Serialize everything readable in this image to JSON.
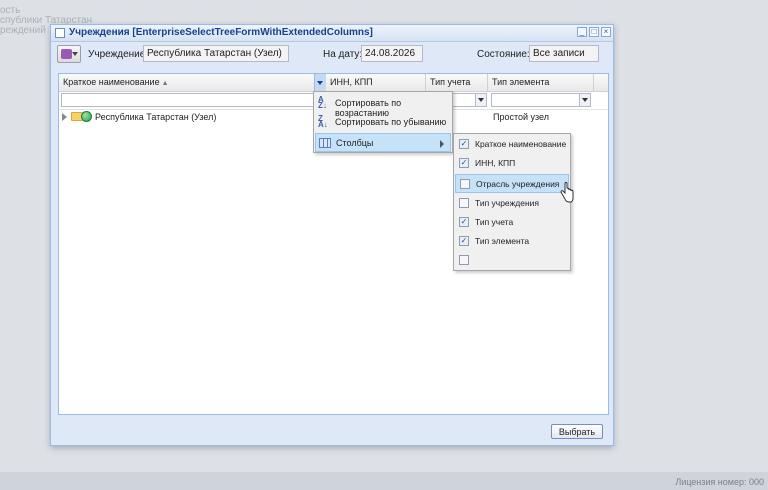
{
  "background": {
    "lines": [
      "ость",
      "спублики Татарстан",
      "реждений"
    ],
    "license": "Лицензия номер: 000"
  },
  "window": {
    "title": "Учреждения [EnterpriseSelectTreeFormWithExtendedColumns]",
    "controls": [
      "minimize-icon",
      "maximize-icon",
      "close-icon"
    ]
  },
  "toolbar": {
    "org_label": "Учреждение:",
    "org_value": "Республика Татарстан (Узел)",
    "date_label": "На дату:",
    "date_value": "24.08.2026",
    "state_label": "Состояние:",
    "state_value": "Все записи"
  },
  "grid": {
    "columns": [
      "Краткое наименование",
      "ИНН, КПП",
      "Тип учета",
      "Тип элемента"
    ],
    "rows": [
      {
        "name": "Республика Татарстан (Узел)",
        "element_type": "Простой узел"
      }
    ]
  },
  "column_menu": {
    "items": [
      "Сортировать по возрастанию",
      "Сортировать по убыванию",
      "Столбцы"
    ],
    "active_index": 2
  },
  "columns_submenu": {
    "items": [
      {
        "label": "Краткое наименование",
        "checked": true
      },
      {
        "label": "ИНН, КПП",
        "checked": true
      },
      {
        "label": "Отрасль учреждения",
        "checked": false
      },
      {
        "label": "Тип учреждения",
        "checked": false
      },
      {
        "label": "Тип учета",
        "checked": true
      },
      {
        "label": "Тип элемента",
        "checked": true
      },
      {
        "label": "",
        "checked": false
      }
    ],
    "active_index": 2
  },
  "footer": {
    "select_label": "Выбрать"
  },
  "colors": {
    "accent": "#99bbe8",
    "highlight": "#c5e2f9",
    "title": "#15428b"
  }
}
